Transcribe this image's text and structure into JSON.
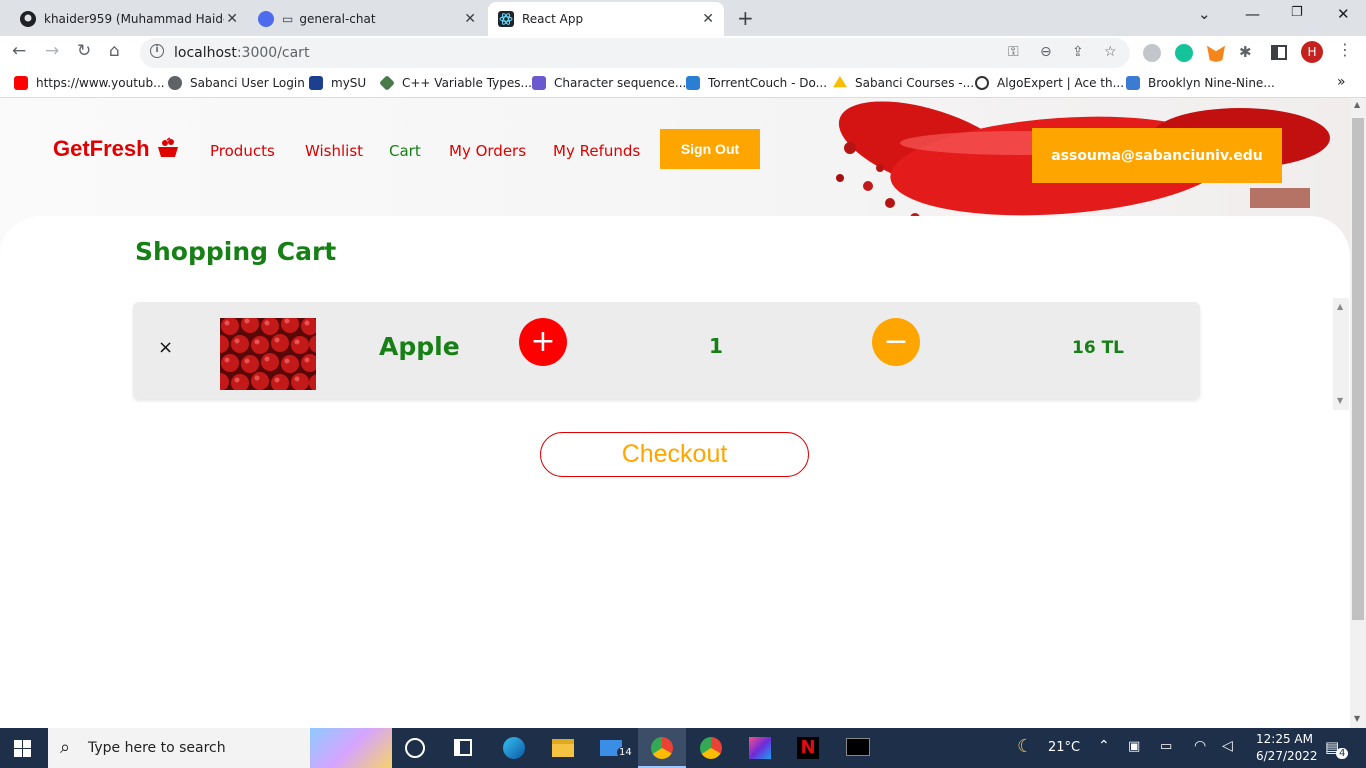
{
  "browser": {
    "tabs": [
      {
        "title": "khaider959 (Muhammad Haider",
        "icon": "github-icon",
        "active": false
      },
      {
        "title": "general-chat",
        "icon": "chat-icon",
        "active": false
      },
      {
        "title": "React App",
        "icon": "react-icon",
        "active": true
      }
    ],
    "address": {
      "host": "localhost",
      "path": ":3000/cart"
    },
    "bookmarks": [
      {
        "label": "https://www.youtub...",
        "icon": "youtube-icon",
        "color": "#ff0000"
      },
      {
        "label": "Sabanci User Login",
        "icon": "globe-icon",
        "color": "#5f6368"
      },
      {
        "label": "mySU",
        "icon": "mysu-icon",
        "color": "#1c3f8f"
      },
      {
        "label": "C++ Variable Types...",
        "icon": "diamond-icon",
        "color": "#4a7a4a"
      },
      {
        "label": "Character sequence...",
        "icon": "cplusplus-icon",
        "color": "#6a5acd"
      },
      {
        "label": "TorrentCouch - Do...",
        "icon": "torrentcouch-icon",
        "color": "#2a7fd4"
      },
      {
        "label": "Sabanci Courses -...",
        "icon": "drive-icon",
        "color": "#fbbc04"
      },
      {
        "label": "AlgoExpert | Ace th...",
        "icon": "algoexpert-icon",
        "color": "#333333"
      },
      {
        "label": "Brooklyn Nine-Nine...",
        "icon": "b99-icon",
        "color": "#3b7bd4"
      }
    ],
    "profile_initial": "H"
  },
  "header": {
    "logo": "GetFresh",
    "nav": [
      {
        "label": "Products",
        "color": "#e00000"
      },
      {
        "label": "Wishlist",
        "color": "#e00000"
      },
      {
        "label": "Cart",
        "color": "#168016"
      },
      {
        "label": "My Orders",
        "color": "#e00000"
      },
      {
        "label": "My Refunds",
        "color": "#e00000"
      }
    ],
    "signout_label": "Sign Out",
    "user_email": "assouma@sabanciuniv.edu"
  },
  "cart": {
    "title": "Shopping Cart",
    "items": [
      {
        "remove_glyph": "×",
        "name": "Apple",
        "plus": "+",
        "quantity": "1",
        "minus": "−",
        "price": "16 TL"
      }
    ],
    "checkout_label": "Checkout"
  },
  "taskbar": {
    "search_placeholder": "Type here to search",
    "mail_badge": "14",
    "temperature": "21°C",
    "time": "12:25 AM",
    "date": "6/27/2022",
    "notifications": "4"
  },
  "colors": {
    "brand_red": "#e00000",
    "brand_green": "#168016",
    "accent_orange": "#ffa500"
  }
}
